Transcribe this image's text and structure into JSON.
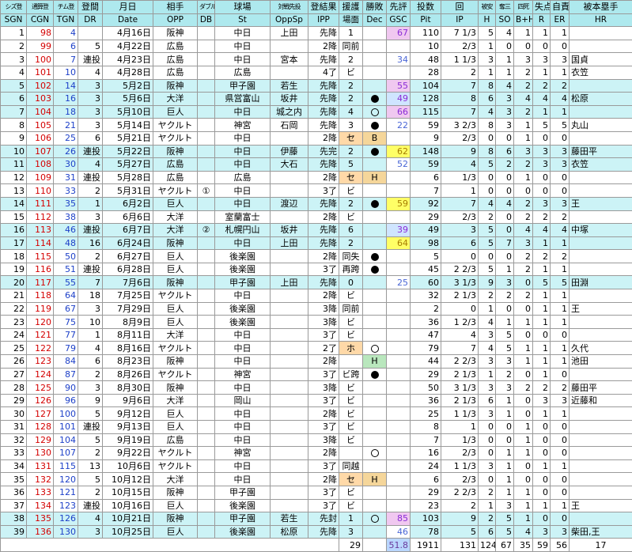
{
  "headers_jp": [
    "シズ登",
    "通算登",
    "チム登",
    "登間",
    "月日",
    "相手",
    "ダブル",
    "球場",
    "対戦先投",
    "登結果",
    "援護",
    "勝敗",
    "先評",
    "投数",
    "回",
    "被安",
    "奪三",
    "四死",
    "失点",
    "自責",
    "被本塁手"
  ],
  "headers_en": [
    "SGN",
    "CGN",
    "TGN",
    "DR",
    "Date",
    "OPP",
    "DB",
    "St",
    "OppSp",
    "IPP",
    "場面",
    "Dec",
    "GSC",
    "Pit",
    "IP",
    "H",
    "SO",
    "B+H",
    "R",
    "ER",
    "HR"
  ],
  "rows": [
    {
      "sgn": "1",
      "cgn": "98",
      "tgn": "4",
      "dr": "",
      "date": "4月16日",
      "opp": "阪神",
      "db": "",
      "st": "中日",
      "oppsp": "上田",
      "ipp": "先降",
      "scene": "1",
      "dec": "",
      "gsc": "67",
      "pit": "110",
      "ip": "7 1/3",
      "h": "5",
      "so": "4",
      "bb": "1",
      "r": "1",
      "er": "1",
      "hr": "",
      "cyan": false,
      "decbg": "",
      "gsccls": "gsc-mid"
    },
    {
      "sgn": "2",
      "cgn": "99",
      "tgn": "6",
      "dr": "5",
      "date": "4月22日",
      "opp": "広島",
      "db": "",
      "st": "中日",
      "oppsp": "",
      "ipp": "2降",
      "scene": "同前",
      "dec": "",
      "gsc": "",
      "pit": "10",
      "ip": "2/3",
      "h": "1",
      "so": "0",
      "bb": "0",
      "r": "0",
      "er": "0",
      "hr": "",
      "cyan": false,
      "decbg": "",
      "gsccls": ""
    },
    {
      "sgn": "3",
      "cgn": "100",
      "tgn": "7",
      "dr": "連投",
      "date": "4月23日",
      "opp": "広島",
      "db": "",
      "st": "中日",
      "oppsp": "宮本",
      "ipp": "先降",
      "scene": "2",
      "dec": "",
      "gsc": "34",
      "pit": "48",
      "ip": "1 1/3",
      "h": "3",
      "so": "1",
      "bb": "3",
      "r": "3",
      "er": "3",
      "hr": "国貞",
      "cyan": false,
      "decbg": "",
      "gsccls": "gsc-lo2"
    },
    {
      "sgn": "4",
      "cgn": "101",
      "tgn": "10",
      "dr": "4",
      "date": "4月28日",
      "opp": "広島",
      "db": "",
      "st": "広島",
      "oppsp": "",
      "ipp": "4了",
      "scene": "ビ",
      "dec": "",
      "gsc": "",
      "pit": "28",
      "ip": "2",
      "h": "1",
      "so": "1",
      "bb": "2",
      "r": "1",
      "er": "1",
      "hr": "衣笠",
      "cyan": false,
      "decbg": "",
      "gsccls": ""
    },
    {
      "sgn": "5",
      "cgn": "102",
      "tgn": "14",
      "dr": "3",
      "date": "5月2日",
      "opp": "阪神",
      "db": "",
      "st": "甲子園",
      "oppsp": "若生",
      "ipp": "先降",
      "scene": "2",
      "dec": "",
      "gsc": "55",
      "pit": "104",
      "ip": "7",
      "h": "8",
      "so": "4",
      "bb": "2",
      "r": "2",
      "er": "2",
      "hr": "",
      "cyan": true,
      "decbg": "",
      "gsccls": "gsc-mid"
    },
    {
      "sgn": "6",
      "cgn": "103",
      "tgn": "16",
      "dr": "3",
      "date": "5月6日",
      "opp": "大洋",
      "db": "",
      "st": "県営富山",
      "oppsp": "坂井",
      "ipp": "先降",
      "scene": "2",
      "dec": "●",
      "gsc": "49",
      "pit": "128",
      "ip": "8",
      "h": "6",
      "so": "3",
      "bb": "4",
      "r": "4",
      "er": "4",
      "hr": "松原",
      "cyan": true,
      "decbg": "",
      "gsccls": "gsc-lo"
    },
    {
      "sgn": "7",
      "cgn": "104",
      "tgn": "18",
      "dr": "3",
      "date": "5月10日",
      "opp": "巨人",
      "db": "",
      "st": "中日",
      "oppsp": "城之内",
      "ipp": "先降",
      "scene": "4",
      "dec": "○",
      "gsc": "66",
      "pit": "115",
      "ip": "7",
      "h": "4",
      "so": "3",
      "bb": "2",
      "r": "1",
      "er": "1",
      "hr": "",
      "cyan": true,
      "decbg": "",
      "gsccls": "gsc-mid"
    },
    {
      "sgn": "8",
      "cgn": "105",
      "tgn": "21",
      "dr": "3",
      "date": "5月14日",
      "opp": "ヤクルト",
      "db": "",
      "st": "神宮",
      "oppsp": "石岡",
      "ipp": "先降",
      "scene": "3",
      "dec": "●",
      "gsc": "22",
      "pit": "59",
      "ip": "3 2/3",
      "h": "8",
      "so": "3",
      "bb": "1",
      "r": "5",
      "er": "5",
      "hr": "丸山",
      "cyan": false,
      "decbg": "",
      "gsccls": "gsc-lo2"
    },
    {
      "sgn": "9",
      "cgn": "106",
      "tgn": "25",
      "dr": "6",
      "date": "5月21日",
      "opp": "ヤクルト",
      "db": "",
      "st": "中日",
      "oppsp": "",
      "ipp": "2降",
      "scene": "セ",
      "dec": "B",
      "gsc": "",
      "pit": "9",
      "ip": "2/3",
      "h": "0",
      "so": "0",
      "bb": "1",
      "r": "0",
      "er": "0",
      "hr": "",
      "cyan": false,
      "decbg": "dec-S",
      "gsccls": ""
    },
    {
      "sgn": "10",
      "cgn": "107",
      "tgn": "26",
      "dr": "連投",
      "date": "5月22日",
      "opp": "阪神",
      "db": "",
      "st": "中日",
      "oppsp": "伊藤",
      "ipp": "先完",
      "scene": "2",
      "dec": "●",
      "gsc": "62",
      "pit": "148",
      "ip": "9",
      "h": "8",
      "so": "6",
      "bb": "3",
      "r": "3",
      "er": "3",
      "hr": "藤田平",
      "cyan": true,
      "decbg": "",
      "gsccls": "gsc-hi"
    },
    {
      "sgn": "11",
      "cgn": "108",
      "tgn": "30",
      "dr": "4",
      "date": "5月27日",
      "opp": "広島",
      "db": "",
      "st": "中日",
      "oppsp": "大石",
      "ipp": "先降",
      "scene": "5",
      "dec": "",
      "gsc": "52",
      "pit": "59",
      "ip": "4",
      "h": "5",
      "so": "2",
      "bb": "2",
      "r": "3",
      "er": "3",
      "hr": "衣笠",
      "cyan": true,
      "decbg": "",
      "gsccls": "gsc-lo2"
    },
    {
      "sgn": "12",
      "cgn": "109",
      "tgn": "31",
      "dr": "連投",
      "date": "5月28日",
      "opp": "広島",
      "db": "",
      "st": "広島",
      "oppsp": "",
      "ipp": "2降",
      "scene": "セ",
      "dec": "H",
      "gsc": "",
      "pit": "6",
      "ip": "1/3",
      "h": "0",
      "so": "0",
      "bb": "1",
      "r": "0",
      "er": "0",
      "hr": "",
      "cyan": false,
      "decbg": "dec-H",
      "gsccls": ""
    },
    {
      "sgn": "13",
      "cgn": "110",
      "tgn": "33",
      "dr": "2",
      "date": "5月31日",
      "opp": "ヤクルト",
      "db": "①",
      "st": "中日",
      "oppsp": "",
      "ipp": "3了",
      "scene": "ビ",
      "dec": "",
      "gsc": "",
      "pit": "7",
      "ip": "1",
      "h": "0",
      "so": "0",
      "bb": "0",
      "r": "0",
      "er": "0",
      "hr": "",
      "cyan": false,
      "decbg": "",
      "gsccls": ""
    },
    {
      "sgn": "14",
      "cgn": "111",
      "tgn": "35",
      "dr": "1",
      "date": "6月2日",
      "opp": "巨人",
      "db": "",
      "st": "中日",
      "oppsp": "渡辺",
      "ipp": "先降",
      "scene": "2",
      "dec": "●",
      "gsc": "59",
      "pit": "92",
      "ip": "7",
      "h": "4",
      "so": "4",
      "bb": "2",
      "r": "3",
      "er": "3",
      "hr": "王",
      "cyan": true,
      "decbg": "",
      "gsccls": "gsc-hi"
    },
    {
      "sgn": "15",
      "cgn": "112",
      "tgn": "38",
      "dr": "3",
      "date": "6月6日",
      "opp": "大洋",
      "db": "",
      "st": "室蘭富士",
      "oppsp": "",
      "ipp": "2降",
      "scene": "ビ",
      "dec": "",
      "gsc": "",
      "pit": "29",
      "ip": "2/3",
      "h": "2",
      "so": "0",
      "bb": "2",
      "r": "2",
      "er": "2",
      "hr": "",
      "cyan": false,
      "decbg": "",
      "gsccls": ""
    },
    {
      "sgn": "16",
      "cgn": "113",
      "tgn": "46",
      "dr": "連投",
      "date": "6月7日",
      "opp": "大洋",
      "db": "②",
      "st": "札幌円山",
      "oppsp": "坂井",
      "ipp": "先降",
      "scene": "6",
      "dec": "",
      "gsc": "39",
      "pit": "49",
      "ip": "3",
      "h": "5",
      "so": "0",
      "bb": "4",
      "r": "4",
      "er": "4",
      "hr": "中塚",
      "cyan": true,
      "decbg": "",
      "gsccls": "gsc-lo"
    },
    {
      "sgn": "17",
      "cgn": "114",
      "tgn": "48",
      "dr": "16",
      "date": "6月24日",
      "opp": "阪神",
      "db": "",
      "st": "中日",
      "oppsp": "上田",
      "ipp": "先降",
      "scene": "2",
      "dec": "",
      "gsc": "64",
      "pit": "98",
      "ip": "6",
      "h": "5",
      "so": "7",
      "bb": "3",
      "r": "1",
      "er": "1",
      "hr": "",
      "cyan": true,
      "decbg": "",
      "gsccls": "gsc-hi"
    },
    {
      "sgn": "18",
      "cgn": "115",
      "tgn": "50",
      "dr": "2",
      "date": "6月27日",
      "opp": "巨人",
      "db": "",
      "st": "後楽園",
      "oppsp": "",
      "ipp": "2降",
      "scene": "同失",
      "dec": "●",
      "gsc": "",
      "pit": "5",
      "ip": "0",
      "h": "0",
      "so": "0",
      "bb": "2",
      "r": "2",
      "er": "2",
      "hr": "",
      "cyan": false,
      "decbg": "",
      "gsccls": ""
    },
    {
      "sgn": "19",
      "cgn": "116",
      "tgn": "51",
      "dr": "連投",
      "date": "6月28日",
      "opp": "巨人",
      "db": "",
      "st": "後楽園",
      "oppsp": "",
      "ipp": "3了",
      "scene": "再跨",
      "dec": "●",
      "gsc": "",
      "pit": "45",
      "ip": "2 2/3",
      "h": "5",
      "so": "1",
      "bb": "2",
      "r": "1",
      "er": "1",
      "hr": "",
      "cyan": false,
      "decbg": "",
      "gsccls": ""
    },
    {
      "sgn": "20",
      "cgn": "117",
      "tgn": "55",
      "dr": "7",
      "date": "7月6日",
      "opp": "阪神",
      "db": "",
      "st": "甲子園",
      "oppsp": "上田",
      "ipp": "先降",
      "scene": "0",
      "dec": "",
      "gsc": "25",
      "pit": "60",
      "ip": "3 1/3",
      "h": "9",
      "so": "3",
      "bb": "0",
      "r": "5",
      "er": "5",
      "hr": "田淵",
      "cyan": true,
      "decbg": "",
      "gsccls": "gsc-lo2"
    },
    {
      "sgn": "21",
      "cgn": "118",
      "tgn": "64",
      "dr": "18",
      "date": "7月25日",
      "opp": "ヤクルト",
      "db": "",
      "st": "中日",
      "oppsp": "",
      "ipp": "2降",
      "scene": "ビ",
      "dec": "",
      "gsc": "",
      "pit": "32",
      "ip": "2 1/3",
      "h": "2",
      "so": "2",
      "bb": "2",
      "r": "1",
      "er": "1",
      "hr": "",
      "cyan": false,
      "decbg": "",
      "gsccls": ""
    },
    {
      "sgn": "22",
      "cgn": "119",
      "tgn": "67",
      "dr": "3",
      "date": "7月29日",
      "opp": "巨人",
      "db": "",
      "st": "後楽園",
      "oppsp": "",
      "ipp": "3降",
      "scene": "同前",
      "dec": "",
      "gsc": "",
      "pit": "2",
      "ip": "0",
      "h": "1",
      "so": "0",
      "bb": "0",
      "r": "1",
      "er": "1",
      "hr": "王",
      "cyan": false,
      "decbg": "",
      "gsccls": ""
    },
    {
      "sgn": "23",
      "cgn": "120",
      "tgn": "75",
      "dr": "10",
      "date": "8月9日",
      "opp": "巨人",
      "db": "",
      "st": "後楽園",
      "oppsp": "",
      "ipp": "3降",
      "scene": "ビ",
      "dec": "",
      "gsc": "",
      "pit": "36",
      "ip": "1 2/3",
      "h": "4",
      "so": "1",
      "bb": "1",
      "r": "1",
      "er": "1",
      "hr": "",
      "cyan": false,
      "decbg": "",
      "gsccls": ""
    },
    {
      "sgn": "24",
      "cgn": "121",
      "tgn": "77",
      "dr": "1",
      "date": "8月11日",
      "opp": "大洋",
      "db": "",
      "st": "中日",
      "oppsp": "",
      "ipp": "3了",
      "scene": "ビ",
      "dec": "",
      "gsc": "",
      "pit": "47",
      "ip": "4",
      "h": "3",
      "so": "5",
      "bb": "0",
      "r": "0",
      "er": "0",
      "hr": "",
      "cyan": false,
      "decbg": "",
      "gsccls": ""
    },
    {
      "sgn": "25",
      "cgn": "122",
      "tgn": "79",
      "dr": "4",
      "date": "8月16日",
      "opp": "ヤクルト",
      "db": "",
      "st": "中日",
      "oppsp": "",
      "ipp": "2了",
      "scene": "ホ",
      "dec": "○",
      "gsc": "",
      "pit": "79",
      "ip": "7",
      "h": "4",
      "so": "5",
      "bb": "1",
      "r": "1",
      "er": "1",
      "hr": "久代",
      "cyan": false,
      "decbg": "",
      "gsccls": "",
      "hand": "hold"
    },
    {
      "sgn": "26",
      "cgn": "123",
      "tgn": "84",
      "dr": "6",
      "date": "8月23日",
      "opp": "阪神",
      "db": "",
      "st": "中日",
      "oppsp": "",
      "ipp": "2降",
      "scene": "",
      "dec": "H",
      "gsc": "",
      "pit": "44",
      "ip": "2 2/3",
      "h": "3",
      "so": "3",
      "bb": "1",
      "r": "1",
      "er": "1",
      "hr": "池田",
      "cyan": false,
      "decbg": "dec-green",
      "gsccls": ""
    },
    {
      "sgn": "27",
      "cgn": "124",
      "tgn": "87",
      "dr": "2",
      "date": "8月26日",
      "opp": "ヤクルト",
      "db": "",
      "st": "神宮",
      "oppsp": "",
      "ipp": "3了",
      "scene": "ビ跨",
      "dec": "●",
      "gsc": "",
      "pit": "29",
      "ip": "2 1/3",
      "h": "1",
      "so": "2",
      "bb": "0",
      "r": "1",
      "er": "0",
      "hr": "",
      "cyan": false,
      "decbg": "",
      "gsccls": ""
    },
    {
      "sgn": "28",
      "cgn": "125",
      "tgn": "90",
      "dr": "3",
      "date": "8月30日",
      "opp": "阪神",
      "db": "",
      "st": "中日",
      "oppsp": "",
      "ipp": "3降",
      "scene": "ビ",
      "dec": "",
      "gsc": "",
      "pit": "50",
      "ip": "3 1/3",
      "h": "3",
      "so": "3",
      "bb": "2",
      "r": "2",
      "er": "2",
      "hr": "藤田平",
      "cyan": false,
      "decbg": "",
      "gsccls": ""
    },
    {
      "sgn": "29",
      "cgn": "126",
      "tgn": "96",
      "dr": "9",
      "date": "9月6日",
      "opp": "大洋",
      "db": "",
      "st": "岡山",
      "oppsp": "",
      "ipp": "3了",
      "scene": "ビ",
      "dec": "",
      "gsc": "",
      "pit": "36",
      "ip": "2 1/3",
      "h": "6",
      "so": "1",
      "bb": "0",
      "r": "3",
      "er": "3",
      "hr": "近藤和",
      "cyan": false,
      "decbg": "",
      "gsccls": ""
    },
    {
      "sgn": "30",
      "cgn": "127",
      "tgn": "100",
      "dr": "5",
      "date": "9月12日",
      "opp": "巨人",
      "db": "",
      "st": "中日",
      "oppsp": "",
      "ipp": "2降",
      "scene": "ビ",
      "dec": "",
      "gsc": "",
      "pit": "25",
      "ip": "1 1/3",
      "h": "3",
      "so": "1",
      "bb": "0",
      "r": "1",
      "er": "1",
      "hr": "",
      "cyan": false,
      "decbg": "",
      "gsccls": ""
    },
    {
      "sgn": "31",
      "cgn": "128",
      "tgn": "101",
      "dr": "連投",
      "date": "9月13日",
      "opp": "巨人",
      "db": "",
      "st": "中日",
      "oppsp": "",
      "ipp": "3了",
      "scene": "ビ",
      "dec": "",
      "gsc": "",
      "pit": "8",
      "ip": "1",
      "h": "0",
      "so": "0",
      "bb": "1",
      "r": "0",
      "er": "0",
      "hr": "",
      "cyan": false,
      "decbg": "",
      "gsccls": ""
    },
    {
      "sgn": "32",
      "cgn": "129",
      "tgn": "104",
      "dr": "5",
      "date": "9月19日",
      "opp": "広島",
      "db": "",
      "st": "中日",
      "oppsp": "",
      "ipp": "3降",
      "scene": "ビ",
      "dec": "",
      "gsc": "",
      "pit": "7",
      "ip": "1/3",
      "h": "0",
      "so": "0",
      "bb": "1",
      "r": "0",
      "er": "0",
      "hr": "",
      "cyan": false,
      "decbg": "",
      "gsccls": ""
    },
    {
      "sgn": "33",
      "cgn": "130",
      "tgn": "107",
      "dr": "2",
      "date": "9月22日",
      "opp": "ヤクルト",
      "db": "",
      "st": "神宮",
      "oppsp": "",
      "ipp": "2降",
      "scene": "",
      "dec": "○",
      "gsc": "",
      "pit": "16",
      "ip": "2/3",
      "h": "0",
      "so": "1",
      "bb": "1",
      "r": "0",
      "er": "0",
      "hr": "",
      "cyan": false,
      "decbg": "",
      "gsccls": ""
    },
    {
      "sgn": "34",
      "cgn": "131",
      "tgn": "115",
      "dr": "13",
      "date": "10月6日",
      "opp": "ヤクルト",
      "db": "",
      "st": "中日",
      "oppsp": "",
      "ipp": "3了",
      "scene": "同越",
      "dec": "",
      "gsc": "",
      "pit": "24",
      "ip": "1 1/3",
      "h": "3",
      "so": "1",
      "bb": "0",
      "r": "1",
      "er": "1",
      "hr": "",
      "cyan": false,
      "decbg": "",
      "gsccls": ""
    },
    {
      "sgn": "35",
      "cgn": "132",
      "tgn": "120",
      "dr": "5",
      "date": "10月12日",
      "opp": "大洋",
      "db": "",
      "st": "中日",
      "oppsp": "",
      "ipp": "2降",
      "scene": "セ",
      "dec": "H",
      "gsc": "",
      "pit": "6",
      "ip": "2/3",
      "h": "0",
      "so": "1",
      "bb": "0",
      "r": "0",
      "er": "0",
      "hr": "",
      "cyan": false,
      "decbg": "dec-H",
      "gsccls": "",
      "hand": "hold"
    },
    {
      "sgn": "36",
      "cgn": "133",
      "tgn": "121",
      "dr": "2",
      "date": "10月15日",
      "opp": "阪神",
      "db": "",
      "st": "甲子園",
      "oppsp": "",
      "ipp": "3了",
      "scene": "ビ",
      "dec": "",
      "gsc": "",
      "pit": "29",
      "ip": "2 2/3",
      "h": "2",
      "so": "1",
      "bb": "1",
      "r": "0",
      "er": "0",
      "hr": "",
      "cyan": false,
      "decbg": "",
      "gsccls": ""
    },
    {
      "sgn": "37",
      "cgn": "134",
      "tgn": "123",
      "dr": "連投",
      "date": "10月16日",
      "opp": "巨人",
      "db": "",
      "st": "後楽園",
      "oppsp": "",
      "ipp": "3了",
      "scene": "ビ",
      "dec": "",
      "gsc": "",
      "pit": "23",
      "ip": "2",
      "h": "1",
      "so": "3",
      "bb": "1",
      "r": "1",
      "er": "1",
      "hr": "王",
      "cyan": false,
      "decbg": "",
      "gsccls": ""
    },
    {
      "sgn": "38",
      "cgn": "135",
      "tgn": "126",
      "dr": "4",
      "date": "10月21日",
      "opp": "阪神",
      "db": "",
      "st": "甲子園",
      "oppsp": "若生",
      "ipp": "先封",
      "scene": "1",
      "dec": "○",
      "gsc": "85",
      "pit": "103",
      "ip": "9",
      "h": "2",
      "so": "5",
      "bb": "1",
      "r": "0",
      "er": "0",
      "hr": "",
      "cyan": true,
      "decbg": "",
      "gsccls": "gsc-mid"
    },
    {
      "sgn": "39",
      "cgn": "136",
      "tgn": "130",
      "dr": "3",
      "date": "10月25日",
      "opp": "巨人",
      "db": "",
      "st": "後楽園",
      "oppsp": "松原",
      "ipp": "先降",
      "scene": "3",
      "dec": "",
      "gsc": "46",
      "pit": "78",
      "ip": "5",
      "h": "6",
      "so": "5",
      "bb": "4",
      "r": "3",
      "er": "3",
      "hr": "柴田,王",
      "cyan": true,
      "decbg": "",
      "gsccls": "gsc-lo2"
    }
  ],
  "totals": {
    "scene": "29",
    "gsc": "51.8",
    "pit": "1911",
    "ip": "131",
    "h": "124",
    "so": "67",
    "bb": "35",
    "r": "59",
    "er": "56",
    "hr": "17"
  },
  "colors": {
    "header_bg": "#aee9ee",
    "row_cyan": "#ccf3f6",
    "dec_green": "#b0e4b8",
    "dec_orange": "#f5d69a",
    "gsc_yellow": "#ffff66",
    "gsc_pink": "#f0c8f0",
    "cgn_red": "#d40000",
    "tgn_blue": "#1c3fc8"
  }
}
